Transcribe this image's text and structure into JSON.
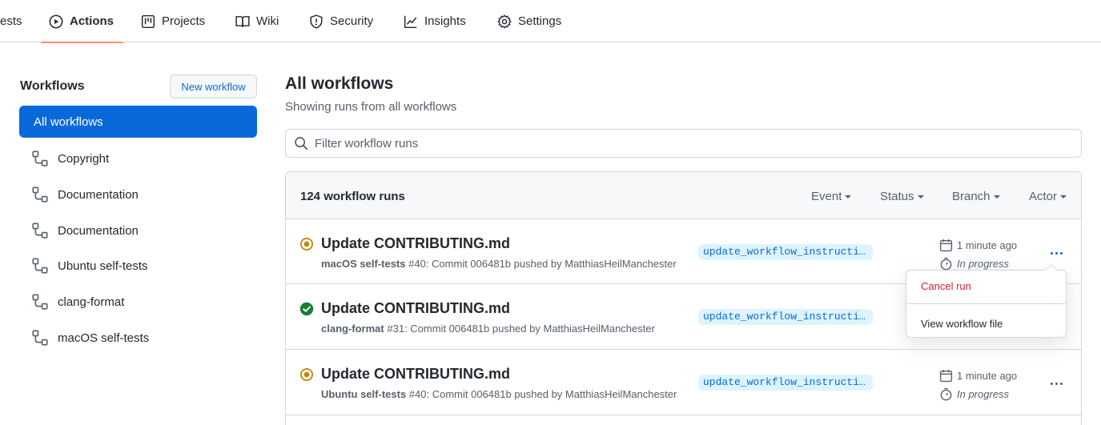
{
  "nav": {
    "tabs": [
      {
        "label": "ests",
        "icon": "pull-request-icon"
      },
      {
        "label": "Actions",
        "icon": "play-icon",
        "active": true
      },
      {
        "label": "Projects",
        "icon": "project-board-icon"
      },
      {
        "label": "Wiki",
        "icon": "book-icon"
      },
      {
        "label": "Security",
        "icon": "shield-icon"
      },
      {
        "label": "Insights",
        "icon": "graph-icon"
      },
      {
        "label": "Settings",
        "icon": "gear-icon"
      }
    ]
  },
  "sidebar": {
    "title": "Workflows",
    "new_button": "New workflow",
    "active_item": "All workflows",
    "items": [
      {
        "label": "Copyright",
        "icon": "workflow-icon"
      },
      {
        "label": "Documentation",
        "icon": "workflow-icon"
      },
      {
        "label": "Documentation",
        "icon": "workflow-icon"
      },
      {
        "label": "Ubuntu self-tests",
        "icon": "workflow-icon"
      },
      {
        "label": "clang-format",
        "icon": "workflow-icon"
      },
      {
        "label": "macOS self-tests",
        "icon": "workflow-icon"
      }
    ]
  },
  "main": {
    "title": "All workflows",
    "subtitle": "Showing runs from all workflows",
    "filter_placeholder": "Filter workflow runs",
    "runs_count": "124 workflow runs",
    "filters": [
      "Event",
      "Status",
      "Branch",
      "Actor"
    ],
    "runs": [
      {
        "title": "Update CONTRIBUTING.md",
        "workflow": "macOS self-tests",
        "details": "#40: Commit 006481b pushed by MatthiasHeilManchester",
        "branch": "update_workflow_instructions",
        "status": "in-progress",
        "time": "1 minute ago",
        "duration": "In progress"
      },
      {
        "title": "Update CONTRIBUTING.md",
        "workflow": "clang-format",
        "details": "#31: Commit 006481b pushed by MatthiasHeilManchester",
        "branch": "update_workflow_instructions",
        "status": "success",
        "time": "",
        "duration": ""
      },
      {
        "title": "Update CONTRIBUTING.md",
        "workflow": "Ubuntu self-tests",
        "details": "#40: Commit 006481b pushed by MatthiasHeilManchester",
        "branch": "update_workflow_instructions",
        "status": "in-progress",
        "time": "1 minute ago",
        "duration": "In progress"
      }
    ]
  },
  "menu": {
    "cancel": "Cancel run",
    "view_file": "View workflow file"
  },
  "colors": {
    "accent": "#0969da",
    "in_progress": "#bf8700",
    "success": "#1a7f37",
    "danger": "#cf222e",
    "active_tab_underline": "#fd8c73"
  }
}
